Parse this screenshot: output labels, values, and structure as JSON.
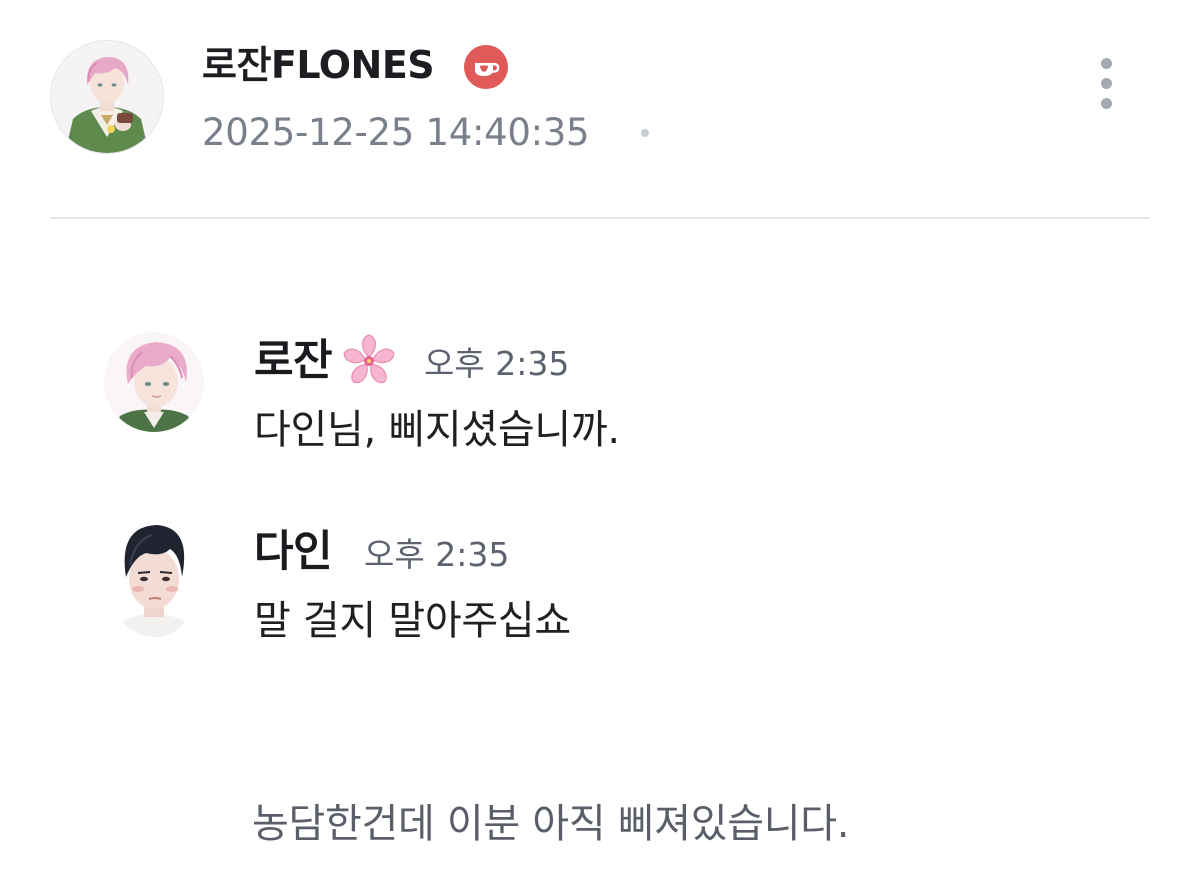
{
  "post": {
    "author_name": "로잔FLONES",
    "timestamp": "2025-12-25 14:40:35",
    "badge_icon": "teacup-badge-icon",
    "more_icon": "more-vertical-icon"
  },
  "chat": {
    "messages": [
      {
        "sender": "로잔",
        "sender_icon": "cherry-blossom-icon",
        "time": "오후 2:35",
        "text": "다인님, 삐지셨습니까."
      },
      {
        "sender": "다인",
        "time": "오후 2:35",
        "text": "말 걸지 말아주십쇼"
      }
    ]
  },
  "caption": "농담한건데 이분 아직 삐져있습니다.",
  "colors": {
    "badge": "#e05a5a",
    "muted_text": "#7a7f8c",
    "divider": "#e5e7ec"
  }
}
